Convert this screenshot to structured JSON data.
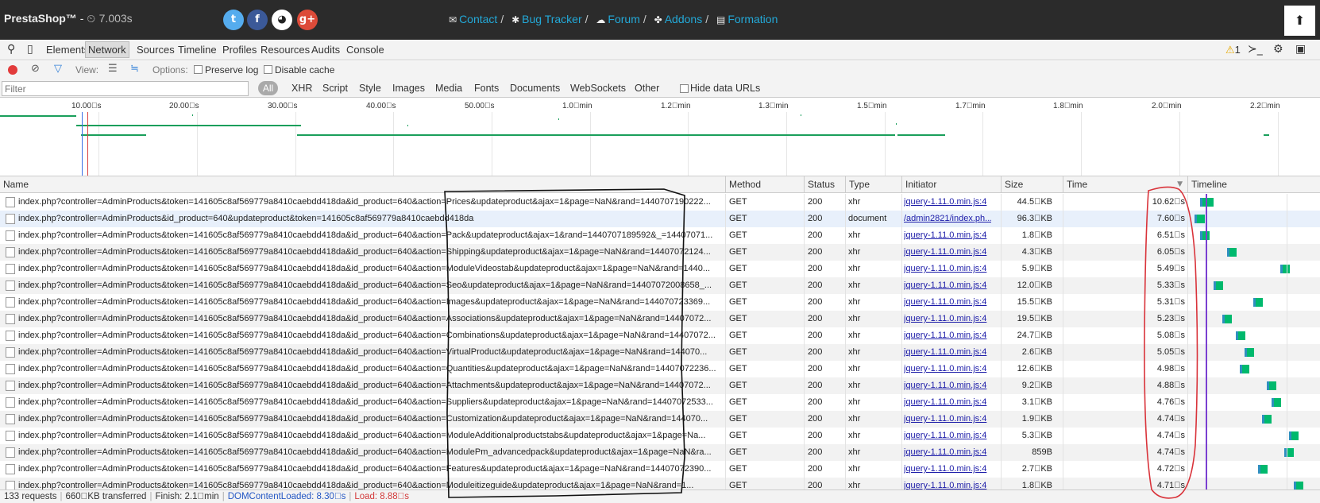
{
  "header": {
    "brand": "PrestaShop™",
    "brand_sep": " - ",
    "timer_icon": "clock-icon",
    "timer": "7.003s",
    "social": [
      {
        "name": "twitter",
        "glyph": "t"
      },
      {
        "name": "facebook",
        "glyph": "f"
      },
      {
        "name": "github",
        "glyph": "◕"
      },
      {
        "name": "google-plus",
        "glyph": "g+"
      }
    ],
    "links": [
      {
        "label": "Contact",
        "icon": "envelope-icon",
        "glyph": "✉"
      },
      {
        "label": "Bug Tracker",
        "icon": "bug-icon",
        "glyph": "✱"
      },
      {
        "label": "Forum",
        "icon": "comments-icon",
        "glyph": "☁"
      },
      {
        "label": "Addons",
        "icon": "puzzle-icon",
        "glyph": "✤"
      },
      {
        "label": "Formation",
        "icon": "book-icon",
        "glyph": "▤"
      }
    ],
    "separator": "/",
    "up_glyph": "⬆"
  },
  "devtools": {
    "tabs": [
      "Elements",
      "Network",
      "Sources",
      "Timeline",
      "Profiles",
      "Resources",
      "Audits",
      "Console"
    ],
    "active_tab": "Network",
    "warning_count": "1"
  },
  "toolbar": {
    "view_label": "View:",
    "options_label": "Options:",
    "preserve_log": "Preserve log",
    "disable_cache": "Disable cache"
  },
  "filter": {
    "placeholder": "Filter",
    "all_label": "All",
    "types": [
      "XHR",
      "Script",
      "Style",
      "Images",
      "Media",
      "Fonts",
      "Documents",
      "WebSockets",
      "Other"
    ],
    "hide_data_urls": "Hide data URLs"
  },
  "overview": {
    "ticks": [
      "10.00\u0000s",
      "20.00\u0000s",
      "30.00\u0000s",
      "40.00\u0000s",
      "50.00\u0000s",
      "1.0\u0000min",
      "1.2\u0000min",
      "1.3\u0000min",
      "1.5\u0000min",
      "1.7\u0000min",
      "1.8\u0000min",
      "2.0\u0000min",
      "2.2\u0000min"
    ]
  },
  "table": {
    "columns": [
      "Name",
      "Method",
      "Status",
      "Type",
      "Initiator",
      "Size",
      "Time",
      "Timeline"
    ],
    "rows": [
      {
        "name": "index.php?controller=AdminProducts&token=141605c8af569779a8410caebdd418da&id_product=640&action=Prices&updateproduct&ajax=1&page=NaN&rand=1440707190222...",
        "method": "GET",
        "status": "200",
        "type": "xhr",
        "initiator": "jquery-1.11.0.min.js:4",
        "size": "44.5\u0000KB",
        "time": "10.62\u0000s",
        "tl_start": 0.0,
        "tl_dur": 0.62
      },
      {
        "name": "index.php?controller=AdminProducts&id_product=640&updateproduct&token=141605c8af569779a8410caebdd418da",
        "method": "GET",
        "status": "200",
        "type": "document",
        "initiator": "/admin2821/index.ph...",
        "size": "96.3\u0000KB",
        "time": "7.60\u0000s",
        "tl_start": -0.25,
        "tl_dur": 0.45
      },
      {
        "name": "index.php?controller=AdminProducts&token=141605c8af569779a8410caebdd418da&id_product=640&action=Pack&updateproduct&ajax=1&rand=1440707189592&_=14407071...",
        "method": "GET",
        "status": "200",
        "type": "xhr",
        "initiator": "jquery-1.11.0.min.js:4",
        "size": "1.8\u0000KB",
        "time": "6.51\u0000s",
        "tl_start": 0.0,
        "tl_dur": 0.4
      },
      {
        "name": "index.php?controller=AdminProducts&token=141605c8af569779a8410caebdd418da&id_product=640&action=Shipping&updateproduct&ajax=1&page=NaN&rand=14407072124...",
        "method": "GET",
        "status": "200",
        "type": "xhr",
        "initiator": "jquery-1.11.0.min.js:4",
        "size": "4.3\u0000KB",
        "time": "6.05\u0000s",
        "tl_start": 1.2,
        "tl_dur": 0.4
      },
      {
        "name": "index.php?controller=AdminProducts&token=141605c8af569779a8410caebdd418da&id_product=640&action=ModuleVideostab&updateproduct&ajax=1&page=NaN&rand=1440...",
        "method": "GET",
        "status": "200",
        "type": "xhr",
        "initiator": "jquery-1.11.0.min.js:4",
        "size": "5.9\u0000KB",
        "time": "5.49\u0000s",
        "tl_start": 3.6,
        "tl_dur": 0.4
      },
      {
        "name": "index.php?controller=AdminProducts&token=141605c8af569779a8410caebdd418da&id_product=640&action=Seo&updateproduct&ajax=1&page=NaN&rand=14407072008658_...",
        "method": "GET",
        "status": "200",
        "type": "xhr",
        "initiator": "jquery-1.11.0.min.js:4",
        "size": "12.0\u0000KB",
        "time": "5.33\u0000s",
        "tl_start": 0.6,
        "tl_dur": 0.4
      },
      {
        "name": "index.php?controller=AdminProducts&token=141605c8af569779a8410caebdd418da&id_product=640&action=Images&updateproduct&ajax=1&page=NaN&rand=14407072336​9...",
        "method": "GET",
        "status": "200",
        "type": "xhr",
        "initiator": "jquery-1.11.0.min.js:4",
        "size": "15.5\u0000KB",
        "time": "5.31\u0000s",
        "tl_start": 2.4,
        "tl_dur": 0.4
      },
      {
        "name": "index.php?controller=AdminProducts&token=141605c8af569779a8410caebdd418da&id_product=640&action=Associations&updateproduct&ajax=1&page=NaN&rand=14407072...",
        "method": "GET",
        "status": "200",
        "type": "xhr",
        "initiator": "jquery-1.11.0.min.js:4",
        "size": "19.5\u0000KB",
        "time": "5.23\u0000s",
        "tl_start": 1.0,
        "tl_dur": 0.4
      },
      {
        "name": "index.php?controller=AdminProducts&token=141605c8af569779a8410caebdd418da&id_product=640&action=Combinations&updateproduct&ajax=1&page=NaN&rand=14407072...",
        "method": "GET",
        "status": "200",
        "type": "xhr",
        "initiator": "jquery-1.11.0.min.js:4",
        "size": "24.7\u0000KB",
        "time": "5.08\u0000s",
        "tl_start": 1.6,
        "tl_dur": 0.4
      },
      {
        "name": "index.php?controller=AdminProducts&token=141605c8af569779a8410caebdd418da&id_product=640&action=VirtualProduct&updateproduct&ajax=1&page=NaN&rand=144070...",
        "method": "GET",
        "status": "200",
        "type": "xhr",
        "initiator": "jquery-1.11.0.min.js:4",
        "size": "2.6\u0000KB",
        "time": "5.05\u0000s",
        "tl_start": 2.0,
        "tl_dur": 0.4
      },
      {
        "name": "index.php?controller=AdminProducts&token=141605c8af569779a8410caebdd418da&id_product=640&action=Quantities&updateproduct&ajax=1&page=NaN&rand=14407072236...",
        "method": "GET",
        "status": "200",
        "type": "xhr",
        "initiator": "jquery-1.11.0.min.js:4",
        "size": "12.6\u0000KB",
        "time": "4.98\u0000s",
        "tl_start": 1.8,
        "tl_dur": 0.4
      },
      {
        "name": "index.php?controller=AdminProducts&token=141605c8af569779a8410caebdd418da&id_product=640&action=Attachments&updateproduct&ajax=1&page=NaN&rand=14407072...",
        "method": "GET",
        "status": "200",
        "type": "xhr",
        "initiator": "jquery-1.11.0.min.js:4",
        "size": "9.2\u0000KB",
        "time": "4.88\u0000s",
        "tl_start": 3.0,
        "tl_dur": 0.4
      },
      {
        "name": "index.php?controller=AdminProducts&token=141605c8af569779a8410caebdd418da&id_product=640&action=Suppliers&updateproduct&ajax=1&page=NaN&rand=14407072533...",
        "method": "GET",
        "status": "200",
        "type": "xhr",
        "initiator": "jquery-1.11.0.min.js:4",
        "size": "3.1\u0000KB",
        "time": "4.76\u0000s",
        "tl_start": 3.2,
        "tl_dur": 0.4
      },
      {
        "name": "index.php?controller=AdminProducts&token=141605c8af569779a8410caebdd418da&id_product=640&action=Customization&updateproduct&ajax=1&page=NaN&rand=144070...",
        "method": "GET",
        "status": "200",
        "type": "xhr",
        "initiator": "jquery-1.11.0.min.js:4",
        "size": "1.9\u0000KB",
        "time": "4.74\u0000s",
        "tl_start": 2.8,
        "tl_dur": 0.4
      },
      {
        "name": "index.php?controller=AdminProducts&token=141605c8af569779a8410caebdd418da&id_product=640&action=ModuleAdditionalproductstabs&updateproduct&ajax=1&page=Na...",
        "method": "GET",
        "status": "200",
        "type": "xhr",
        "initiator": "jquery-1.11.0.min.js:4",
        "size": "5.3\u0000KB",
        "time": "4.74\u0000s",
        "tl_start": 4.0,
        "tl_dur": 0.4
      },
      {
        "name": "index.php?controller=AdminProducts&token=141605c8af569779a8410caebdd418da&id_product=640&action=ModulePm_advancedpack&updateproduct&ajax=1&page=NaN&ra...",
        "method": "GET",
        "status": "200",
        "type": "xhr",
        "initiator": "jquery-1.11.0.min.js:4",
        "size": "859B",
        "time": "4.74\u0000s",
        "tl_start": 3.8,
        "tl_dur": 0.4
      },
      {
        "name": "index.php?controller=AdminProducts&token=141605c8af569779a8410caebdd418da&id_product=640&action=Features&updateproduct&ajax=1&page=NaN&rand=14407072390...",
        "method": "GET",
        "status": "200",
        "type": "xhr",
        "initiator": "jquery-1.11.0.min.js:4",
        "size": "2.7\u0000KB",
        "time": "4.72\u0000s",
        "tl_start": 2.6,
        "tl_dur": 0.4
      },
      {
        "name": "index.php?controller=AdminProducts&token=141605c8af569779a8410caebdd418da&id_product=640&action=Moduleitizeguide&updateproduct&ajax=1&page=NaN&rand=1...",
        "method": "GET",
        "status": "200",
        "type": "xhr",
        "initiator": "jquery-1.11.0.min.js:4",
        "size": "1.8\u0000KB",
        "time": "4.71\u0000s",
        "tl_start": 4.2,
        "tl_dur": 0.4
      }
    ]
  },
  "footer": {
    "requests": "133 requests",
    "transferred": "660\u0000KB transferred",
    "finish": "Finish: 2.1\u0000min",
    "dom_loaded": "DOMContentLoaded: 8.30\u0000s",
    "load": "Load: 8.88\u0000s"
  },
  "colors": {
    "accent_link": "#23a9d8",
    "timeline_green": "#00b96d",
    "annotation_black": "#111111",
    "annotation_red": "#d9333a"
  }
}
